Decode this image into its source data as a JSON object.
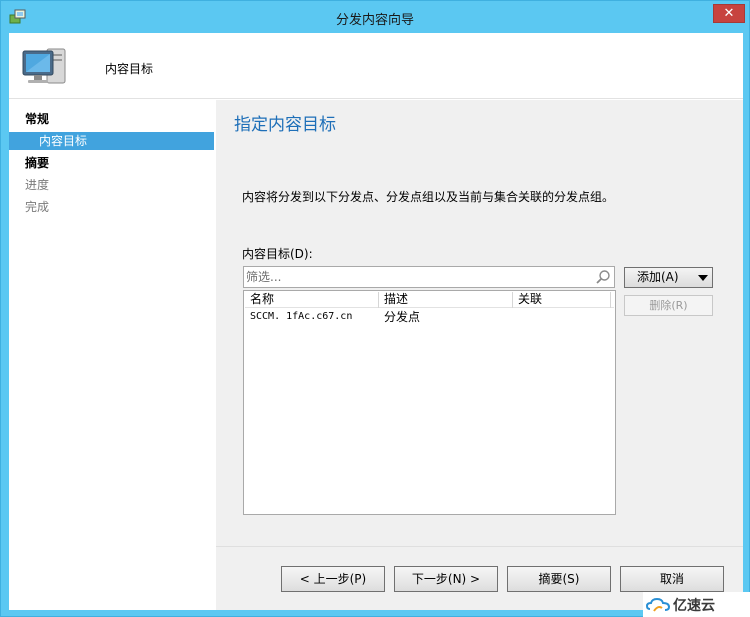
{
  "window": {
    "title": "分发内容向导",
    "close_label": "✕"
  },
  "header": {
    "title": "内容目标"
  },
  "nav": {
    "general": "常规",
    "content_destination": "内容目标",
    "summary": "摘要",
    "progress": "进度",
    "completion": "完成"
  },
  "main": {
    "heading": "指定内容目标",
    "description": "内容将分发到以下分发点、分发点组以及当前与集合关联的分发点组。",
    "list_label": "内容目标(D):",
    "filter_placeholder": "筛选...",
    "columns": [
      "名称",
      "描述",
      "关联"
    ],
    "rows": [
      {
        "name": "SCCM. 1fAc.c67.cn",
        "description": "分发点",
        "association": ""
      }
    ],
    "add_label": "添加(A)",
    "delete_label": "删除(R)"
  },
  "footer": {
    "prev_label": "< 上一步(P)",
    "next_label": "下一步(N) >",
    "summary_label": "摘要(S)",
    "cancel_label": "取消"
  },
  "watermark": {
    "text": "亿速云"
  },
  "colors": {
    "titlebar": "#5bc8f2",
    "nav_selected": "#41a3de",
    "heading": "#1e6fb8",
    "close": "#c7433f"
  }
}
